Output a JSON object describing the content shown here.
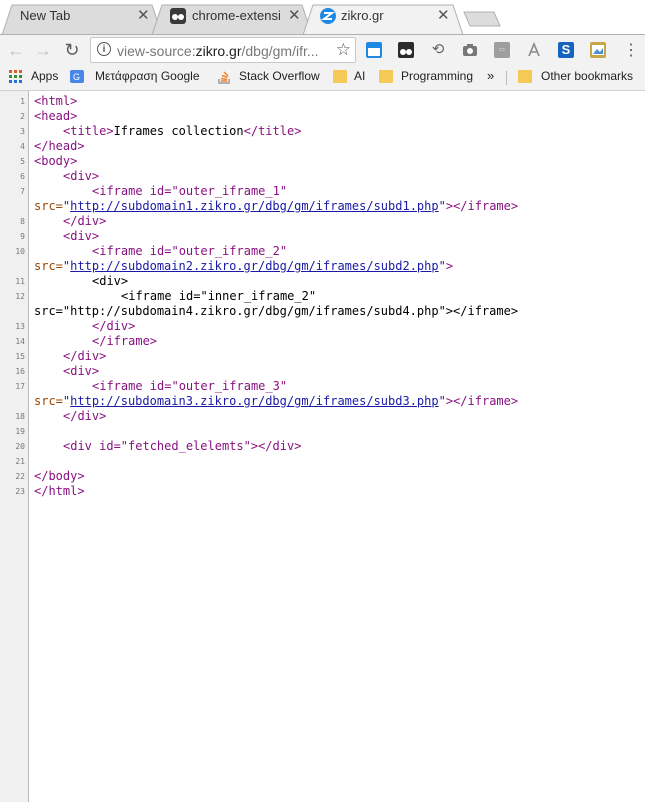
{
  "tabs": [
    {
      "label": "New Tab",
      "active": false
    },
    {
      "label": "chrome-extensio",
      "active": false
    },
    {
      "label": "zikro.gr",
      "active": true
    }
  ],
  "toolbar": {
    "url_scheme": "view-source:",
    "url_host": "zikro.gr",
    "url_path": "/dbg/gm/ifr..."
  },
  "bookmarks": [
    {
      "label": "Apps",
      "icon": "apps-grid-icon"
    },
    {
      "label": "Μετάφραση Google",
      "icon": "google-translate-icon"
    },
    {
      "label": "Stack Overflow",
      "icon": "stackoverflow-icon"
    },
    {
      "label": "AI",
      "icon": "folder-icon"
    },
    {
      "label": "Programming",
      "icon": "folder-icon"
    },
    {
      "label": "»",
      "icon": "chevron-double-right-icon"
    },
    {
      "label": "Other bookmarks",
      "icon": "folder-icon"
    }
  ],
  "source_lines": [
    {
      "num": "1"
    },
    {
      "num": "2"
    },
    {
      "num": "3"
    },
    {
      "num": "4"
    },
    {
      "num": "5"
    },
    {
      "num": "6"
    },
    {
      "num": "7"
    },
    {
      "num": "8"
    },
    {
      "num": "9"
    },
    {
      "num": "10"
    },
    {
      "num": "11"
    },
    {
      "num": "12"
    },
    {
      "num": "13"
    },
    {
      "num": "14"
    },
    {
      "num": "15"
    },
    {
      "num": "16"
    },
    {
      "num": "17"
    },
    {
      "num": "18"
    },
    {
      "num": "19"
    },
    {
      "num": "20"
    },
    {
      "num": "21"
    },
    {
      "num": "22"
    },
    {
      "num": "23"
    }
  ],
  "code": {
    "html_open": "<html>",
    "head_open": "<head>",
    "title_open": "<title>",
    "title_text": "Iframes collection",
    "title_close": "</title>",
    "head_close": "</head>",
    "body_open": "<body>",
    "div_open": "<div>",
    "div_close": "</div>",
    "iframe1_open": "<iframe id=\"outer_iframe_1\"",
    "src_attr": "src=",
    "quote": "\"",
    "iframe1_src": "http://subdomain1.zikro.gr/dbg/gm/iframes/subd1.php",
    "tag_end": ">",
    "iframe_close": "</iframe>",
    "iframe2_open": "<iframe id=\"outer_iframe_2\"",
    "iframe2_src": "http://subdomain2.zikro.gr/dbg/gm/iframes/subd2.php",
    "inner_iframe_open": "<iframe id=\"inner_iframe_2\"",
    "inner_src_text": "src=\"http://subdomain4.zikro.gr/dbg/gm/iframes/subd4.php\"></iframe>",
    "iframe3_open": "<iframe id=\"outer_iframe_3\"",
    "iframe3_src": "http://subdomain3.zikro.gr/dbg/gm/iframes/subd3.php",
    "fetched_div": "<div id=\"fetched_elelemts\"></div>",
    "body_close": "</body>",
    "html_close": "</html>"
  }
}
